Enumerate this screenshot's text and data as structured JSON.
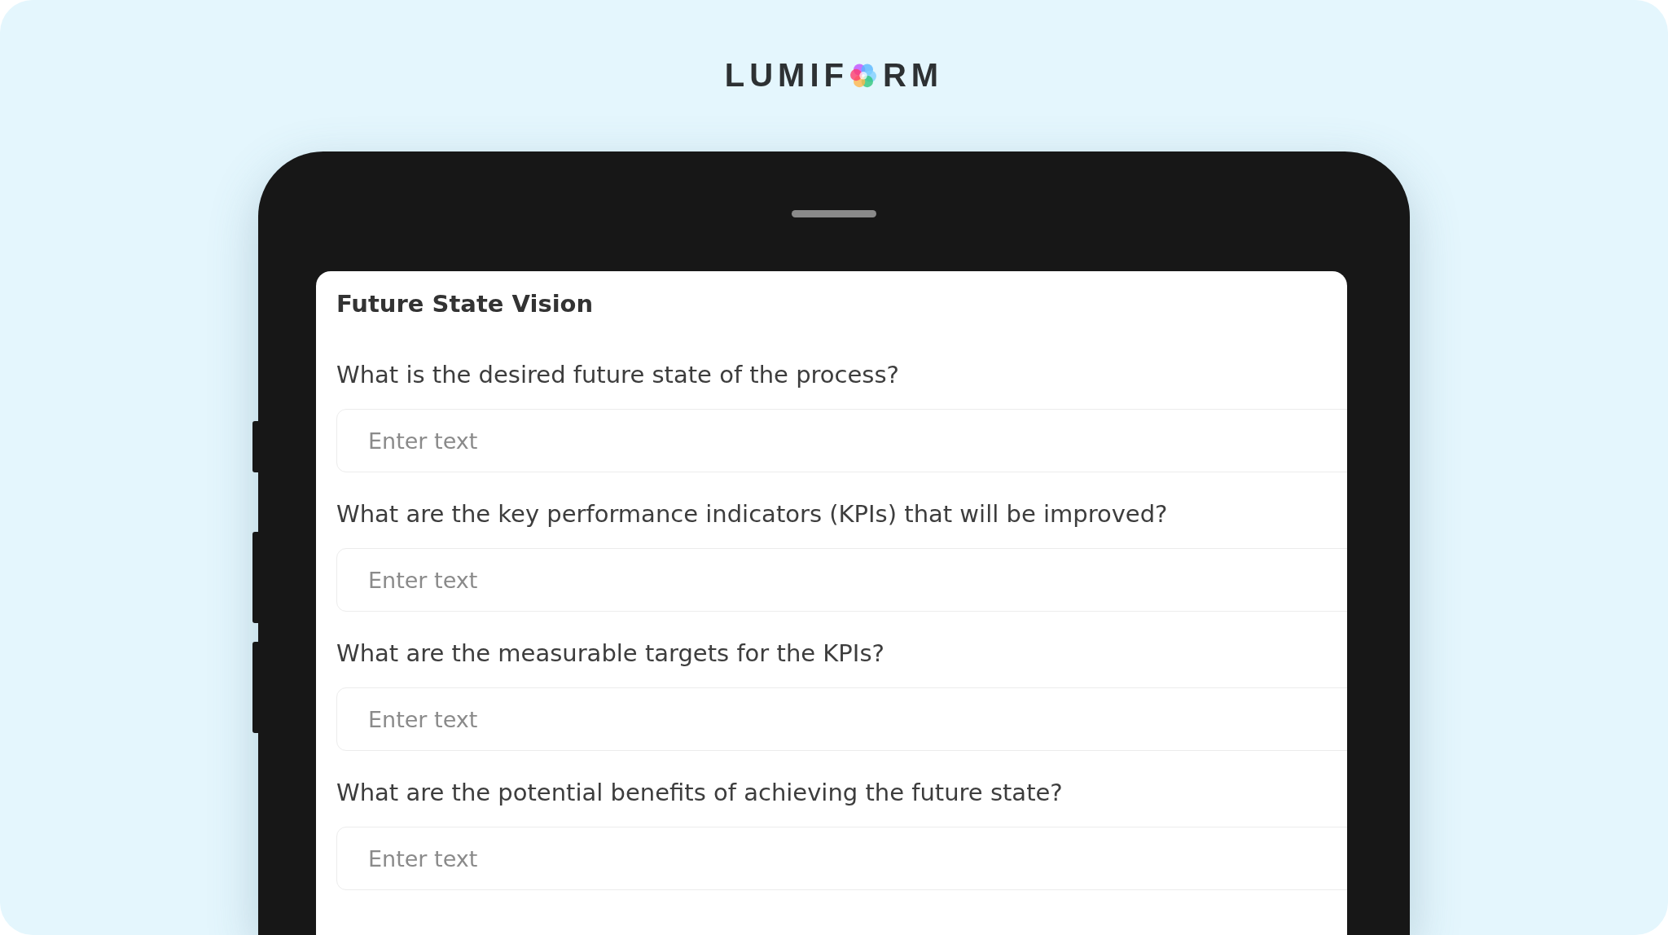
{
  "logo": {
    "before": "LUMIF",
    "after": "RM"
  },
  "form": {
    "title": "Future State Vision",
    "questions": [
      {
        "label": "What is the desired future state of the process?",
        "placeholder": "Enter text"
      },
      {
        "label": "What are the key performance indicators (KPIs) that will be improved?",
        "placeholder": "Enter text"
      },
      {
        "label": "What are the measurable targets for the KPIs?",
        "placeholder": "Enter text"
      },
      {
        "label": "What are the potential benefits of achieving the future state?",
        "placeholder": "Enter text"
      }
    ]
  }
}
